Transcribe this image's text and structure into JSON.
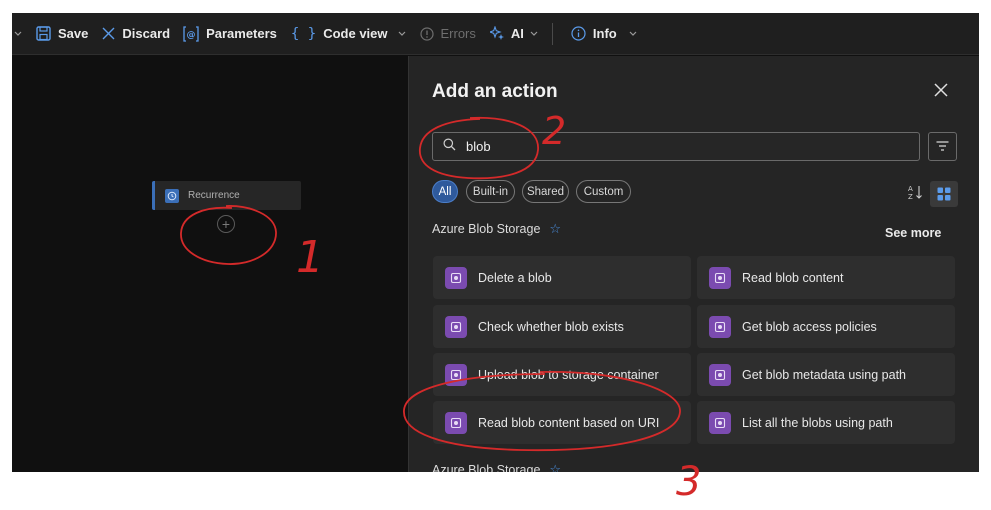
{
  "toolbar": {
    "save_label": "Save",
    "discard_label": "Discard",
    "parameters_label": "Parameters",
    "code_view_label": "Code view",
    "errors_label": "Errors",
    "ai_label": "AI",
    "info_label": "Info"
  },
  "canvas": {
    "trigger_label": "Recurrence"
  },
  "panel": {
    "title": "Add an action",
    "search": {
      "value": "blob"
    },
    "chips": [
      "All",
      "Built-in",
      "Shared",
      "Custom"
    ],
    "active_chip": "All",
    "sort_icon": "sort-az-icon",
    "view_icon": "grid-view-icon",
    "sections": [
      {
        "title": "Azure Blob Storage",
        "see_more": "See more",
        "actions": [
          "Delete a blob",
          "Read blob content",
          "Check whether blob exists",
          "Get blob access policies",
          "Upload blob to storage container",
          "Get blob metadata using path",
          "Read blob content based on URI",
          "List all the blobs using path"
        ]
      },
      {
        "title": "Azure Blob Storage"
      }
    ]
  },
  "annotations": {
    "step1": "1",
    "step2": "2",
    "step3": "3"
  },
  "colors": {
    "accent": "#3b6fb8",
    "connector_icon": "#7b4bb0",
    "annotation": "#d42a2a"
  }
}
